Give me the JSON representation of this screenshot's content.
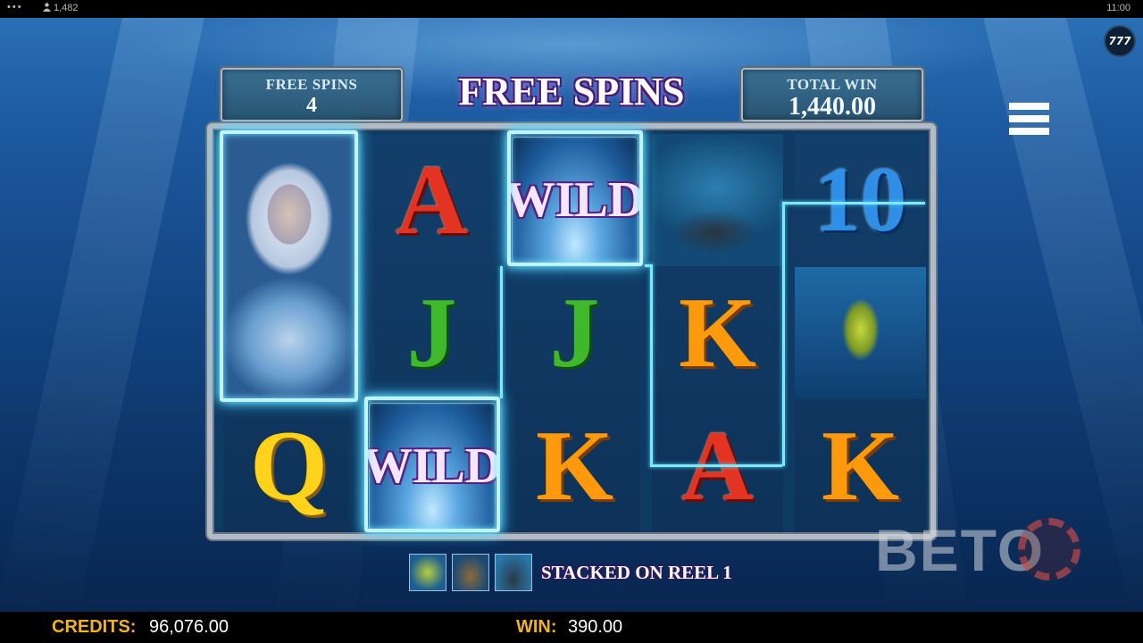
{
  "topbar": {
    "players": "1,482",
    "clock": "11:00",
    "menu_dots": "•••"
  },
  "badge": "777",
  "header": {
    "free_spins_label": "FREE SPINS",
    "free_spins_value": "4",
    "title": "FREE SPINS",
    "total_win_label": "TOTAL WIN",
    "total_win_value": "1,440.00"
  },
  "reels": {
    "reel1": [
      "mermaid",
      "mermaid",
      "Q"
    ],
    "reel2": [
      "A",
      "J",
      "WILD"
    ],
    "reel3": [
      "WILD",
      "J",
      "K"
    ],
    "reel4": [
      "reef",
      "K",
      "A"
    ],
    "reel5": [
      "10",
      "leafy-sea-dragon",
      "K"
    ],
    "labels": {
      "wild": "WILD",
      "A": "A",
      "J": "J",
      "Q": "Q",
      "K": "K",
      "ten": "10"
    }
  },
  "stacked": {
    "text": "STACKED ON REEL 1",
    "icons": [
      "leafy-sea-dragon-icon",
      "treasure-chest-icon",
      "reef-icon"
    ]
  },
  "watermark": "BETO",
  "footer": {
    "credits_label": "CREDITS:",
    "credits_value": "96,076.00",
    "win_label": "WIN:",
    "win_value": "390.00"
  },
  "colors": {
    "accent_gold": "#f0b321",
    "glow": "#6fe3ff",
    "title_purple": "#4a1a6e"
  }
}
